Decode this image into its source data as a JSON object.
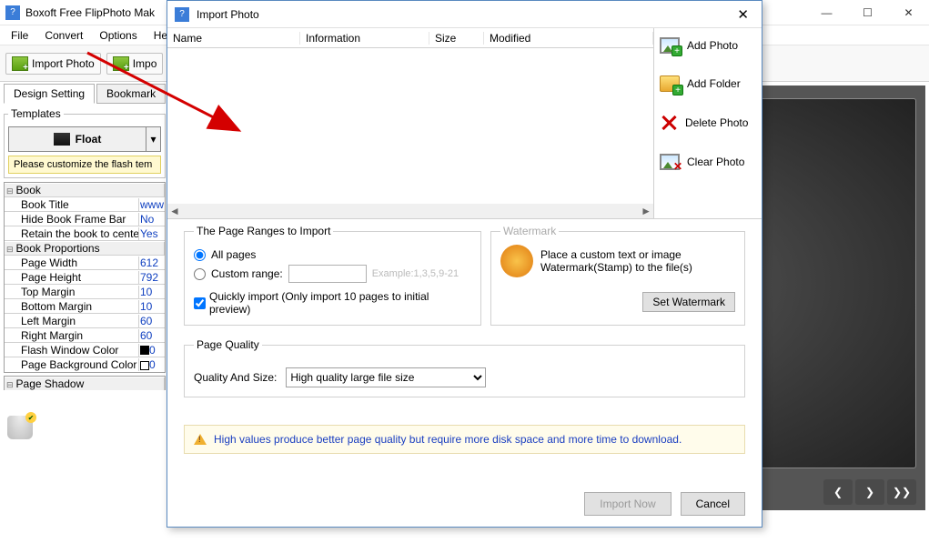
{
  "main_title": "Boxoft Free FlipPhoto Mak",
  "menu": [
    "File",
    "Convert",
    "Options",
    "Hel"
  ],
  "toolbar": {
    "import_photo": "Import Photo",
    "import_partial": "Impo"
  },
  "tabs": {
    "design": "Design Setting",
    "bookmark": "Bookmark"
  },
  "templates": {
    "legend": "Templates",
    "float": "Float",
    "hint": "Please customize the flash tem"
  },
  "props": {
    "book": "Book",
    "rows": [
      {
        "k": "Book Title",
        "v": "www"
      },
      {
        "k": "Hide Book Frame Bar",
        "v": "No"
      },
      {
        "k": "Retain the book to center",
        "v": "Yes"
      }
    ],
    "proportions": "Book Proportions",
    "prop_rows": [
      {
        "k": "Page Width",
        "v": "612"
      },
      {
        "k": "Page Height",
        "v": "792"
      }
    ],
    "margin_rows": [
      {
        "k": "Top Margin",
        "v": "10"
      },
      {
        "k": "Bottom Margin",
        "v": "10"
      },
      {
        "k": "Left Margin",
        "v": "60"
      },
      {
        "k": "Right Margin",
        "v": "60"
      },
      {
        "k": "Flash Window Color",
        "v": "0"
      },
      {
        "k": "Page Background Color",
        "v": "0"
      }
    ],
    "page_shadow": "Page Shadow"
  },
  "dialog": {
    "title": "Import Photo",
    "cols": {
      "name": "Name",
      "info": "Information",
      "size": "Size",
      "modified": "Modified"
    },
    "side": {
      "add_photo": "Add Photo",
      "add_folder": "Add Folder",
      "delete_photo": "Delete Photo",
      "clear_photo": "Clear Photo"
    },
    "ranges_legend": "The Page Ranges to Import",
    "all_pages": "All pages",
    "custom_range": "Custom range:",
    "example": "Example:1,3,5,9-21",
    "quick": "Quickly import (Only import 10 pages to  initial  preview)",
    "watermark_legend": "Watermark",
    "wm_text": "Place a custom text or image Watermark(Stamp) to the file(s)",
    "set_wm": "Set Watermark",
    "quality_legend": "Page Quality",
    "quality_label": "Quality And Size:",
    "quality_value": "High quality large file size",
    "info": "High values produce better page quality but require more disk space and more time to download.",
    "import_now": "Import Now",
    "cancel": "Cancel"
  }
}
